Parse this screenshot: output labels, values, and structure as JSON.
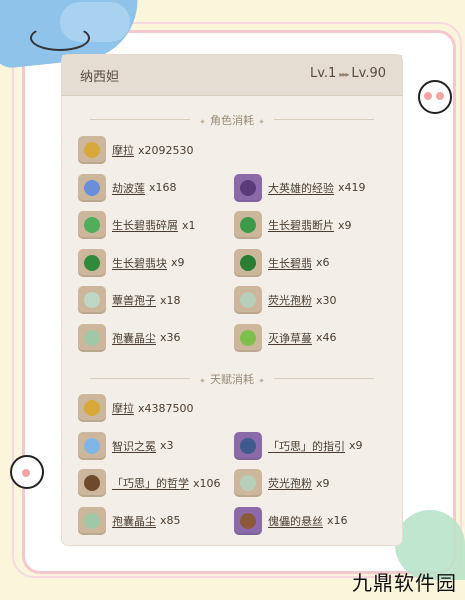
{
  "character": {
    "name": "纳西妲",
    "level_from": "Lv.1",
    "level_to": "Lv.90"
  },
  "sections": [
    {
      "title": "角色消耗",
      "items": [
        {
          "name": "摩拉",
          "qty": "x2092530",
          "icon": "mora-coin-icon",
          "color": "#d8a93a",
          "wide": true
        },
        {
          "name": "劫波莲",
          "qty": "x168",
          "icon": "kalpalata-lotus-icon",
          "color": "#6a8fd6"
        },
        {
          "name": "大英雄的经验",
          "qty": "x419",
          "icon": "heros-wit-book-icon",
          "color": "#5b3b7a",
          "purple": true
        },
        {
          "name": "生长碧翡碎屑",
          "qty": "x1",
          "icon": "nagadus-emerald-sliver-icon",
          "color": "#4fae5a"
        },
        {
          "name": "生长碧翡断片",
          "qty": "x9",
          "icon": "nagadus-emerald-fragment-icon",
          "color": "#3d9a48"
        },
        {
          "name": "生长碧翡块",
          "qty": "x9",
          "icon": "nagadus-emerald-chunk-icon",
          "color": "#2f8a3c"
        },
        {
          "name": "生长碧翡",
          "qty": "x6",
          "icon": "nagadus-emerald-gemstone-icon",
          "color": "#2a7d33"
        },
        {
          "name": "蕈兽孢子",
          "qty": "x18",
          "icon": "fungal-spores-icon",
          "color": "#bfd8c6"
        },
        {
          "name": "荧光孢粉",
          "qty": "x30",
          "icon": "luminescent-pollen-icon",
          "color": "#b8cfbb"
        },
        {
          "name": "孢囊晶尘",
          "qty": "x36",
          "icon": "crystalline-cyst-dust-icon",
          "color": "#9fc7a8"
        },
        {
          "name": "灭诤草蔓",
          "qty": "x46",
          "icon": "quelled-creeper-icon",
          "color": "#7fbf4d"
        }
      ]
    },
    {
      "title": "天赋消耗",
      "items": [
        {
          "name": "摩拉",
          "qty": "x4387500",
          "icon": "mora-coin-icon",
          "color": "#d8a93a",
          "wide": true
        },
        {
          "name": "智识之冕",
          "qty": "x3",
          "icon": "crown-of-insight-icon",
          "color": "#7fb6e6"
        },
        {
          "name": "「巧思」的指引",
          "qty": "x9",
          "icon": "guide-to-ingenuity-icon",
          "color": "#3f5a8c",
          "purple": true
        },
        {
          "name": "「巧思」的哲学",
          "qty": "x106",
          "icon": "philosophies-of-ingenuity-icon",
          "color": "#6e4a2c"
        },
        {
          "name": "荧光孢粉",
          "qty": "x9",
          "icon": "luminescent-pollen-icon",
          "color": "#b8cfbb"
        },
        {
          "name": "孢囊晶尘",
          "qty": "x85",
          "icon": "crystalline-cyst-dust-icon",
          "color": "#9fc7a8"
        },
        {
          "name": "傀儡的悬丝",
          "qty": "x16",
          "icon": "puppet-strings-icon",
          "color": "#8c5a3a",
          "purple": true
        }
      ]
    }
  ],
  "watermark": "九鼎软件园"
}
